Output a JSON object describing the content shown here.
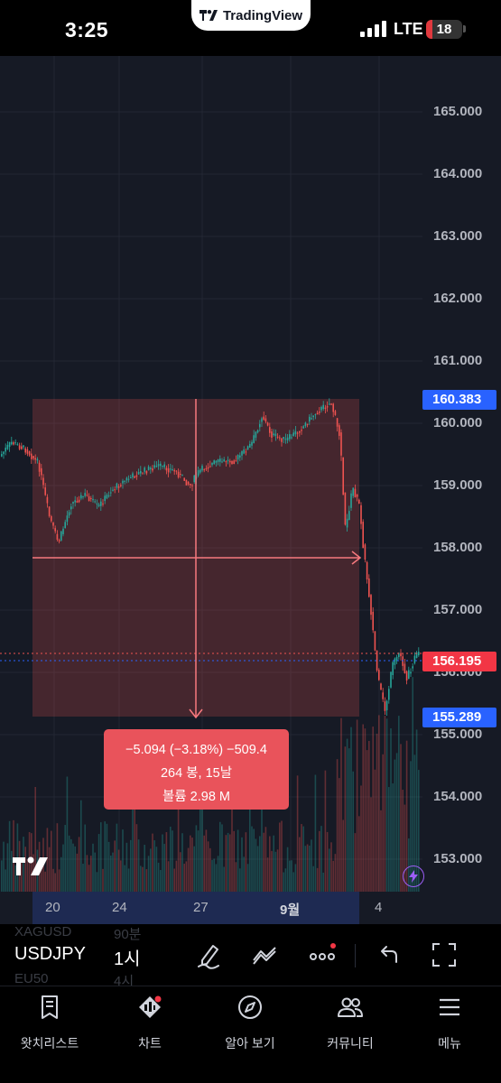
{
  "status_bar": {
    "time": "3:25",
    "app_badge": "TradingView",
    "network": "LTE",
    "battery": "18",
    "battery_level": 0.18
  },
  "chart": {
    "price_ticks": [
      "165.000",
      "164.000",
      "163.000",
      "162.000",
      "161.000",
      "160.000",
      "159.000",
      "158.000",
      "157.000",
      "156.000",
      "155.000",
      "154.000",
      "153.000"
    ],
    "high_tag": "160.383",
    "current_tag": "156.195",
    "low_tag": "155.289",
    "time_ticks": [
      "20",
      "24",
      "27",
      "9월",
      "4"
    ],
    "measure": {
      "line1": "−5.094 (−3.18%) −509.4",
      "line2": "264 봉, 15날",
      "line3": "볼륨 2.98 M"
    },
    "colors": {
      "up": "#26a69a",
      "down": "#ef5350",
      "background": "#161a25",
      "measure_fill": "#e9535b",
      "accent_blue": "#2962ff"
    }
  },
  "toolbar": {
    "symbol": "USDJPY",
    "interval": "1시",
    "ghost_symbol_above": "XAGUSD",
    "ghost_interval_above": "90분",
    "ghost_symbol_below": "EU50",
    "ghost_interval_below": "4시",
    "icons": [
      "draw-icon",
      "indicators-icon",
      "more-icon",
      "undo-icon",
      "fullscreen-icon"
    ]
  },
  "bottom_nav": {
    "items": [
      {
        "label": "왓치리스트",
        "icon": "watchlist-icon"
      },
      {
        "label": "차트",
        "icon": "chart-icon"
      },
      {
        "label": "알아 보기",
        "icon": "compass-icon"
      },
      {
        "label": "커뮤니티",
        "icon": "community-icon"
      },
      {
        "label": "메뉴",
        "icon": "menu-icon"
      }
    ]
  }
}
